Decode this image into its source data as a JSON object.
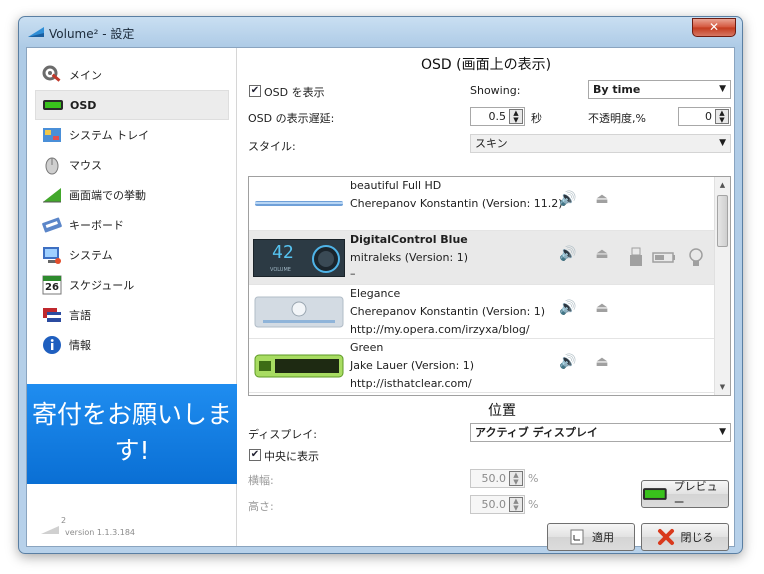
{
  "window": {
    "title": "Volume² - 設定",
    "close_symbol": "✕"
  },
  "sidebar": {
    "items": [
      {
        "label": "メイン",
        "icon": "settings-tools-icon"
      },
      {
        "label": "OSD",
        "icon": "osd-bar-icon"
      },
      {
        "label": "システム トレイ",
        "icon": "tray-icon"
      },
      {
        "label": "マウス",
        "icon": "mouse-icon"
      },
      {
        "label": "画面端での挙動",
        "icon": "screen-edge-icon"
      },
      {
        "label": "キーボード",
        "icon": "keyboard-icon"
      },
      {
        "label": "システム",
        "icon": "system-icon"
      },
      {
        "label": "スケジュール",
        "icon": "calendar-icon"
      },
      {
        "label": "言語",
        "icon": "language-flag-icon"
      },
      {
        "label": "情報",
        "icon": "info-icon"
      }
    ],
    "calendar_day": "26",
    "donate_text": "寄付をお願いします!",
    "logo_superscript": "2",
    "version": "version 1.1.3.184"
  },
  "osd": {
    "heading": "OSD (画面上の表示)",
    "show_osd_label": "OSD を表示",
    "show_osd_checked": true,
    "showing_label": "Showing:",
    "showing_value": "By time",
    "delay_label": "OSD の表示遅延:",
    "delay_value": "0.5",
    "delay_unit": "秒",
    "opacity_label": "不透明度,%",
    "opacity_value": "0",
    "style_label": "スタイル:",
    "style_value": "スキン",
    "skins": [
      {
        "name": "beautiful Full HD",
        "author": "Cherepanov Konstantin (Version: 11.2)",
        "extra": "",
        "selected": false
      },
      {
        "name": "DigitalControl Blue",
        "author": "mitraleks (Version: 1)",
        "extra": "–",
        "selected": true,
        "display_number": "42",
        "thumb_caption": "VOLUME"
      },
      {
        "name": "Elegance",
        "author": "Cherepanov Konstantin (Version: 1)",
        "extra": "http://my.opera.com/irzyxa/blog/",
        "selected": false
      },
      {
        "name": "Green",
        "author": "Jake Lauer (Version: 1)",
        "extra": "http://isthatclear.com/",
        "selected": false
      }
    ]
  },
  "position": {
    "heading": "位置",
    "display_label": "ディスプレイ:",
    "display_value": "アクティブ ディスプレイ",
    "center_label": "中央に表示",
    "center_checked": true,
    "horizontal_label": "横幅:",
    "horizontal_value": "50.0",
    "vertical_label": "高さ:",
    "vertical_value": "50.0",
    "percent": "%"
  },
  "buttons": {
    "preview": "プレビュー",
    "apply": "適用",
    "close": "閉じる"
  }
}
